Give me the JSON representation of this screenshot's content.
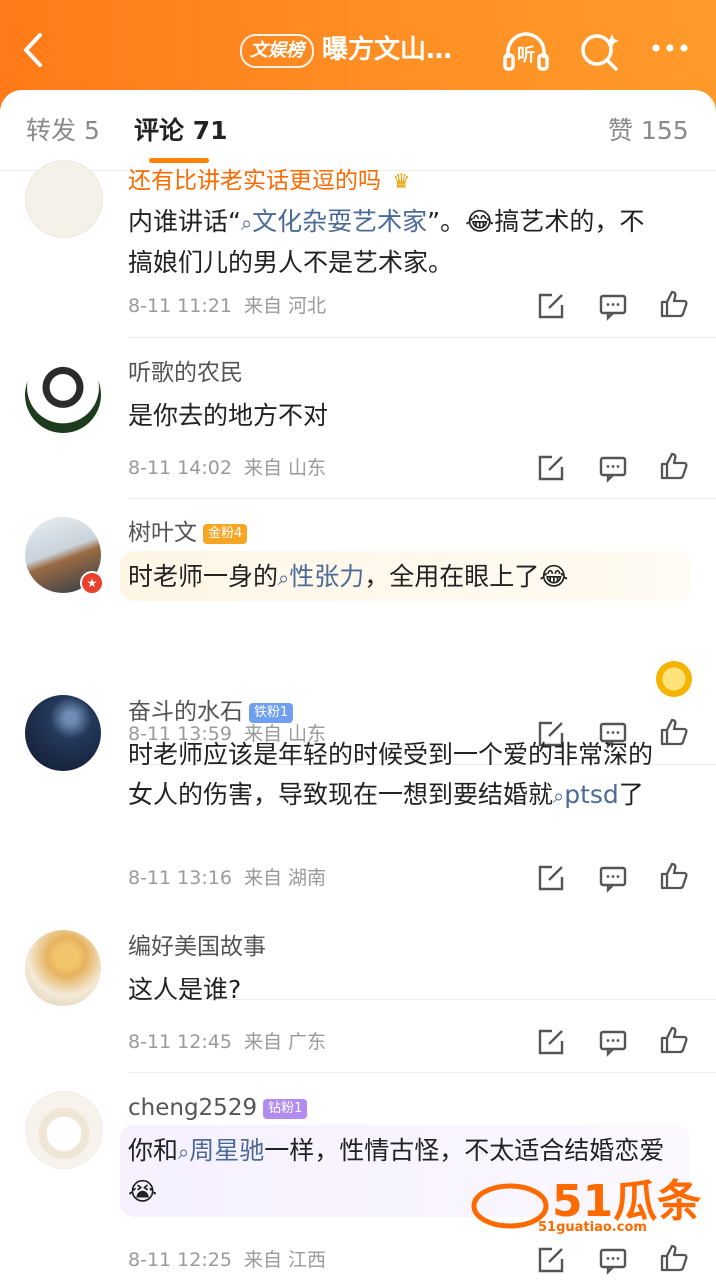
{
  "header": {
    "back_icon": "chevron-left-icon",
    "badge": "文娱榜",
    "title": "曝方文山…",
    "listen_icon": "headphone-icon",
    "listen_label": "听",
    "search_icon": "search-icon",
    "more_icon": "more-icon"
  },
  "tabs": {
    "repost": "转发 5",
    "comments": "评论 71",
    "likes": "赞 155"
  },
  "comments": [
    {
      "name": "还有比讲老实话更逗的吗",
      "text_before": "内谁讲话“",
      "topic": "文化杂耍艺术家",
      "text_after": "”。😂搞艺术的，不搞娘们儿的男人不是艺术家。",
      "time": "8-11 11:21",
      "location": "来自 河北"
    },
    {
      "name": "听歌的农民",
      "text": "是你去的地方不对",
      "time": "8-11 14:02",
      "location": "来自 山东"
    },
    {
      "name": "树叶文",
      "fan": "金粉4",
      "text_before": "时老师一身的",
      "topic": "性张力",
      "text_after": "，全用在眼上了😂",
      "time": "8-11 13:59",
      "location": "来自 山东"
    },
    {
      "name": "奋斗的水石",
      "fan": "铁粉1",
      "text_before": "时老师应该是年轻的时候受到一个爱的非常深的女人的伤害，导致现在一想到要结婚就",
      "topic": "ptsd",
      "text_after": "了",
      "time": "8-11 13:16",
      "location": "来自 湖南"
    },
    {
      "name": "编好美国故事",
      "text": "这人是谁?",
      "time": "8-11 12:45",
      "location": "来自 广东"
    },
    {
      "name": "cheng2529",
      "fan": "钻粉1",
      "text_before": "你和",
      "topic": "周星驰",
      "text_after": "一样，性情古怪，不太适合结婚恋爱😭",
      "time": "8-11 12:25",
      "location": "来自 江西"
    }
  ],
  "actions": {
    "share_icon": "share-icon",
    "reply_icon": "comment-icon",
    "like_icon": "thumbs-up-icon"
  },
  "watermark": {
    "logo": "51瓜条",
    "url": "51guatiao.com"
  },
  "colors": {
    "accent": "#ff8200",
    "topic": "#4a6b9a",
    "gold": "#f5a623",
    "iron": "#6e9ff0",
    "diamond": "#b28cf0"
  }
}
